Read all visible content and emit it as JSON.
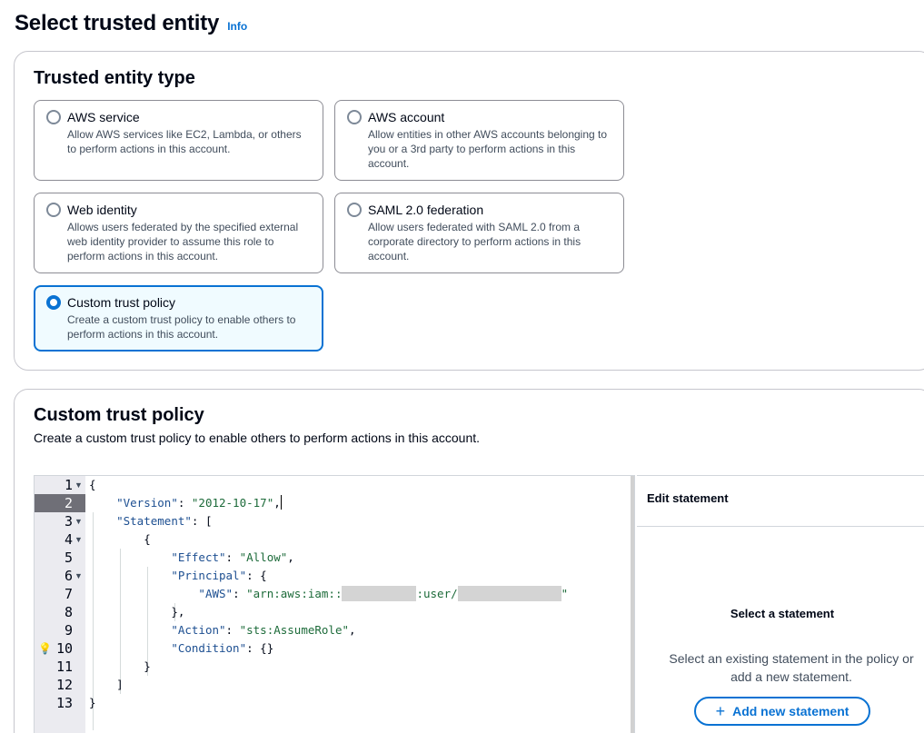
{
  "header": {
    "title": "Select trusted entity",
    "info": "Info"
  },
  "entity_section": {
    "title": "Trusted entity type",
    "options": [
      {
        "label": "AWS service",
        "desc": "Allow AWS services like EC2, Lambda, or others to perform actions in this account.",
        "selected": false
      },
      {
        "label": "AWS account",
        "desc": "Allow entities in other AWS accounts belonging to you or a 3rd party to perform actions in this account.",
        "selected": false
      },
      {
        "label": "Web identity",
        "desc": "Allows users federated by the specified external web identity provider to assume this role to perform actions in this account.",
        "selected": false
      },
      {
        "label": "SAML 2.0 federation",
        "desc": "Allow users federated with SAML 2.0 from a corporate directory to perform actions in this account.",
        "selected": false
      },
      {
        "label": "Custom trust policy",
        "desc": "Create a custom trust policy to enable others to perform actions in this account.",
        "selected": true
      }
    ]
  },
  "policy_section": {
    "title": "Custom trust policy",
    "description": "Create a custom trust policy to enable others to perform actions in this account.",
    "active_line": 2,
    "lines": [
      {
        "num": "1",
        "fold": true
      },
      {
        "num": "2",
        "fold": false
      },
      {
        "num": "3",
        "fold": true
      },
      {
        "num": "4",
        "fold": true
      },
      {
        "num": "5",
        "fold": false
      },
      {
        "num": "6",
        "fold": true
      },
      {
        "num": "7",
        "fold": false
      },
      {
        "num": "8",
        "fold": false
      },
      {
        "num": "9",
        "fold": false
      },
      {
        "num": "10",
        "fold": false,
        "bulb": true
      },
      {
        "num": "11",
        "fold": false
      },
      {
        "num": "12",
        "fold": false
      },
      {
        "num": "13",
        "fold": false
      }
    ],
    "code": {
      "open_brace": "{",
      "version_key": "\"Version\"",
      "version_val": "\"2012-10-17\"",
      "statement_key": "\"Statement\"",
      "bracket_open": "[",
      "obj_open": "{",
      "effect_key": "\"Effect\"",
      "effect_val": "\"Allow\"",
      "principal_key": "\"Principal\"",
      "principal_open": "{",
      "aws_key": "\"AWS\"",
      "aws_prefix": "\"arn:aws:iam::",
      "aws_middle": ":user/",
      "aws_suffix": "\"",
      "principal_close": "},",
      "action_key": "\"Action\"",
      "action_val": "\"sts:AssumeRole\"",
      "condition_key": "\"Condition\"",
      "condition_val": "{}",
      "obj_close": "}",
      "bracket_close": "]",
      "close_brace": "}"
    },
    "editor_panel": {
      "header": "Edit statement",
      "empty_title": "Select a statement",
      "empty_text": "Select an existing statement in the policy or add a new statement.",
      "add_button": "Add new statement",
      "add_icon": "+"
    }
  }
}
